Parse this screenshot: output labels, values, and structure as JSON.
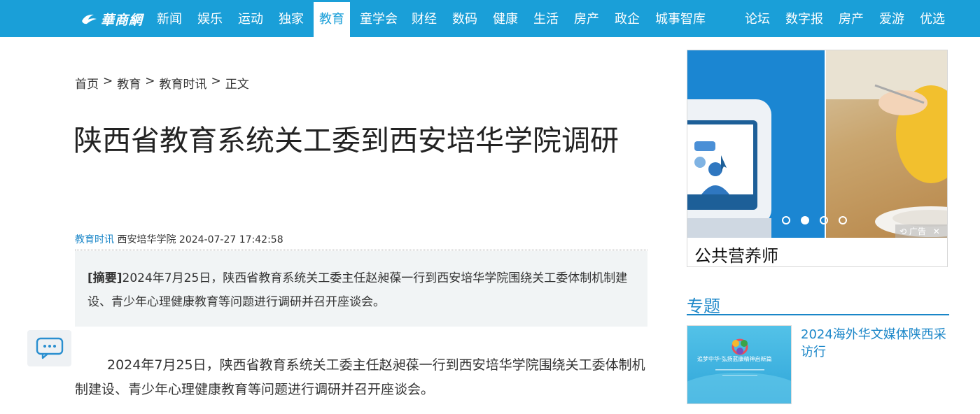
{
  "nav": {
    "logo_text": "華商網",
    "items": [
      "新闻",
      "娱乐",
      "运动",
      "独家",
      "教育",
      "童学会",
      "财经",
      "数码",
      "健康",
      "生活",
      "房产",
      "政企",
      "城事智库"
    ],
    "right_items": [
      "论坛",
      "数字报",
      "房产",
      "爱游",
      "优选"
    ],
    "active": "教育"
  },
  "breadcrumb": [
    "首页",
    "教育",
    "教育时讯",
    "正文"
  ],
  "breadcrumb_sep": ">",
  "article": {
    "title": "陕西省教育系统关工委到西安培华学院调研",
    "category": "教育时讯",
    "source": "西安培华学院",
    "datetime": "2024-07-27 17:42:58",
    "abstract_label": "[摘要]",
    "abstract": "2024年7月25日，陕西省教育系统关工委主任赵昶葆一行到西安培华学院围绕关工委体制机制建设、青少年心理健康教育等问题进行调研并召开座谈会。",
    "body": "2024年7月25日，陕西省教育系统关工委主任赵昶葆一行到西安培华学院围绕关工委体制机制建设、青少年心理健康教育等问题进行调研并召开座谈会。"
  },
  "ad": {
    "caption": "公共营养师",
    "tag": "广告",
    "slide_count": 4,
    "active_slide": 2
  },
  "sidebar": {
    "section_title": "专题",
    "topic": {
      "title": "2024海外华文媒体陕西采访行",
      "image_text": "追梦中华·弘扬蓝康精神启新篇"
    }
  },
  "colors": {
    "brand": "#1a9fd8",
    "link": "#1a86c8"
  }
}
